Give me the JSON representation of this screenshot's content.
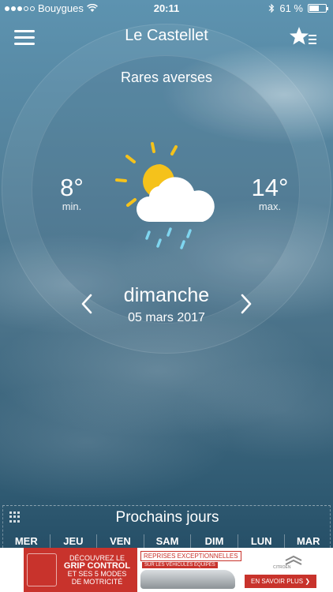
{
  "status_bar": {
    "carrier": "Bouygues",
    "time": "20:11",
    "battery": "61 %",
    "battery_level": 0.61
  },
  "header": {
    "title": "Le Castellet",
    "menu_icon": "hamburger-menu-icon",
    "favorites_icon": "star-list-icon"
  },
  "weather": {
    "condition": "Rares averses",
    "min_temp": "8°",
    "min_label": "min.",
    "max_temp": "14°",
    "max_label": "max.",
    "icon": "sun-cloud-rain-icon"
  },
  "day_nav": {
    "day": "dimanche",
    "date": "05 mars 2017"
  },
  "next_days": {
    "title": "Prochains jours",
    "days": [
      "MER",
      "JEU",
      "VEN",
      "SAM",
      "DIM",
      "LUN",
      "MAR"
    ]
  },
  "ad": {
    "left_line1": "DÉCOUVREZ LE",
    "left_line2": "GRIP CONTROL",
    "left_line3": "ET SES 5 MODES",
    "left_line4": "DE MOTRICITÉ",
    "badge1": "REPRISES EXCEPTIONNELLES",
    "badge2": "SUR LES VÉHICULES ÉQUIPÉS",
    "brand": "CITROËN",
    "cta": "EN SAVOIR PLUS ❯",
    "accent_color": "#c8332c"
  },
  "colors": {
    "sun": "#f5c21b",
    "rain": "#7fd6f0"
  }
}
